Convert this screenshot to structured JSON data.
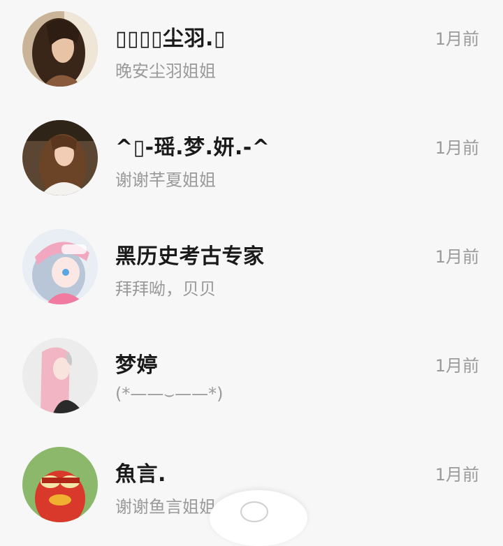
{
  "conversations": [
    {
      "name": "▯▯▯▯尘羽.▯",
      "preview": "晚安尘羽姐姐",
      "time": "1月前",
      "avatar": "photo-girl-dark-hair-icon"
    },
    {
      "name": "^▯-瑶.梦.妍.-^",
      "preview": "谢谢芊夏姐姐",
      "time": "1月前",
      "avatar": "photo-girl-long-hair-icon"
    },
    {
      "name": "黑历史考古专家",
      "preview": "拜拜呦，贝贝",
      "time": "1月前",
      "avatar": "anime-girl-pink-cap-icon"
    },
    {
      "name": "梦婷",
      "preview": "(*——⌣——*)",
      "time": "1月前",
      "avatar": "anime-girl-pink-hair-icon"
    },
    {
      "name": "魚言.",
      "preview": "谢谢鱼言姐姐",
      "time": "1月前",
      "avatar": "red-larva-cartoon-icon"
    }
  ],
  "colors": {
    "background": "#f7f7f7",
    "name": "#1a1a1a",
    "secondary": "#9a9a9a"
  }
}
